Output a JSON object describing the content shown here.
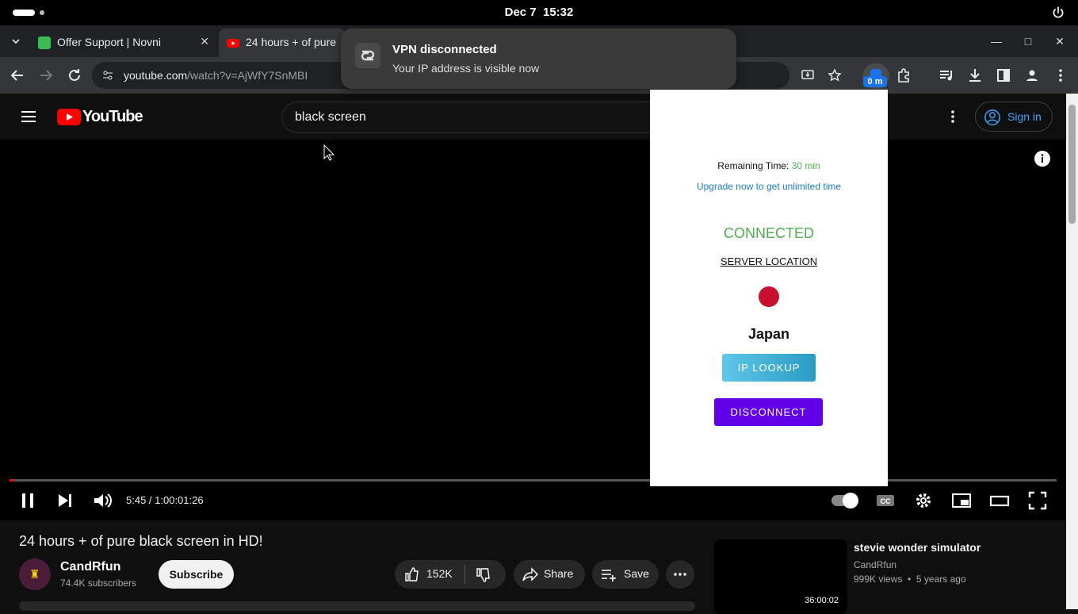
{
  "os": {
    "date": "Dec 7",
    "time": "15:32"
  },
  "tabs": [
    {
      "title": "Offer Support | Novni",
      "active": false
    },
    {
      "title": "24 hours + of pure",
      "active": true
    }
  ],
  "toolbar": {
    "url_host": "youtube.com",
    "url_path": "/watch?v=AjWfY7SnMBI",
    "extension_badge": "0 m"
  },
  "notification": {
    "title": "VPN disconnected",
    "body": "Your IP address is visible now"
  },
  "youtube": {
    "logo_text": "YouTube",
    "search_value": "black screen",
    "signin_label": "Sign in"
  },
  "player": {
    "time": "5:45 / 1:00:01:26",
    "progress_fraction": 0.0016
  },
  "video": {
    "title": "24 hours + of pure black screen in HD!",
    "channel": "CandRfun",
    "subscribers": "74.4K subscribers",
    "subscribe_label": "Subscribe",
    "likes": "152K",
    "share_label": "Share",
    "save_label": "Save"
  },
  "recommended": {
    "title": "stevie wonder simulator",
    "channel": "CandRfun",
    "views": "999K views",
    "age": "5 years ago",
    "duration": "36:00:02"
  },
  "vpn": {
    "remaining_label": "Remaining Time:",
    "remaining_value": "30 min",
    "upgrade_link": "Upgrade now to get unlimited time",
    "status": "CONNECTED",
    "server_location_label": "SERVER LOCATION",
    "country": "Japan",
    "ip_lookup_label": "IP LOOKUP",
    "disconnect_label": "DISCONNECT",
    "colors": {
      "connected": "#4caf50",
      "flag": "#c8102e",
      "disconnect_bg": "#6200ea"
    }
  }
}
